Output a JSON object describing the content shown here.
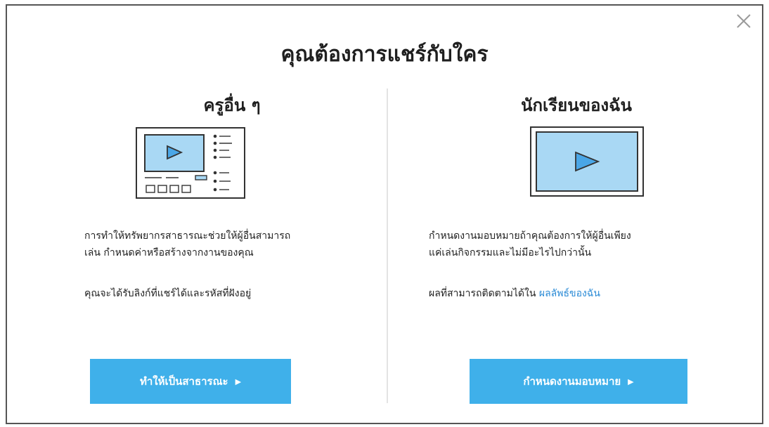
{
  "dialog": {
    "title": "คุณต้องการแชร์กับใคร",
    "close_icon": "close-icon"
  },
  "left": {
    "heading": "ครูอื่น ๆ",
    "description_line1": "การทำให้ทรัพยากรสาธารณะช่วยให้ผู้อื่นสามารถ",
    "description_line2": "เล่น กำหนดค่าหรือสร้างจากงานของคุณ",
    "note": "คุณจะได้รับลิงก์ที่แชร์ได้และรหัสที่ฝังอยู่",
    "button_label": "ทำให้เป็นสาธารณะ",
    "button_icon": "caret-right-icon"
  },
  "right": {
    "heading": "นักเรียนของฉัน",
    "description_line1": "กำหนดงานมอบหมายถ้าคุณต้องการให้ผู้อื่นเพียง",
    "description_line2": "แค่เล่นกิจกรรมและไม่มีอะไรไปกว่านั้น",
    "note_prefix": "ผลที่สามารถติดตามได้ใน ",
    "note_link": "ผลลัพธ์ของฉัน",
    "button_label": "กำหนดงานมอบหมาย",
    "button_icon": "caret-right-icon"
  },
  "colors": {
    "accent_button": "#3fb0ea",
    "link": "#2b8bd6",
    "illustration_fill": "#a9d8f4"
  }
}
